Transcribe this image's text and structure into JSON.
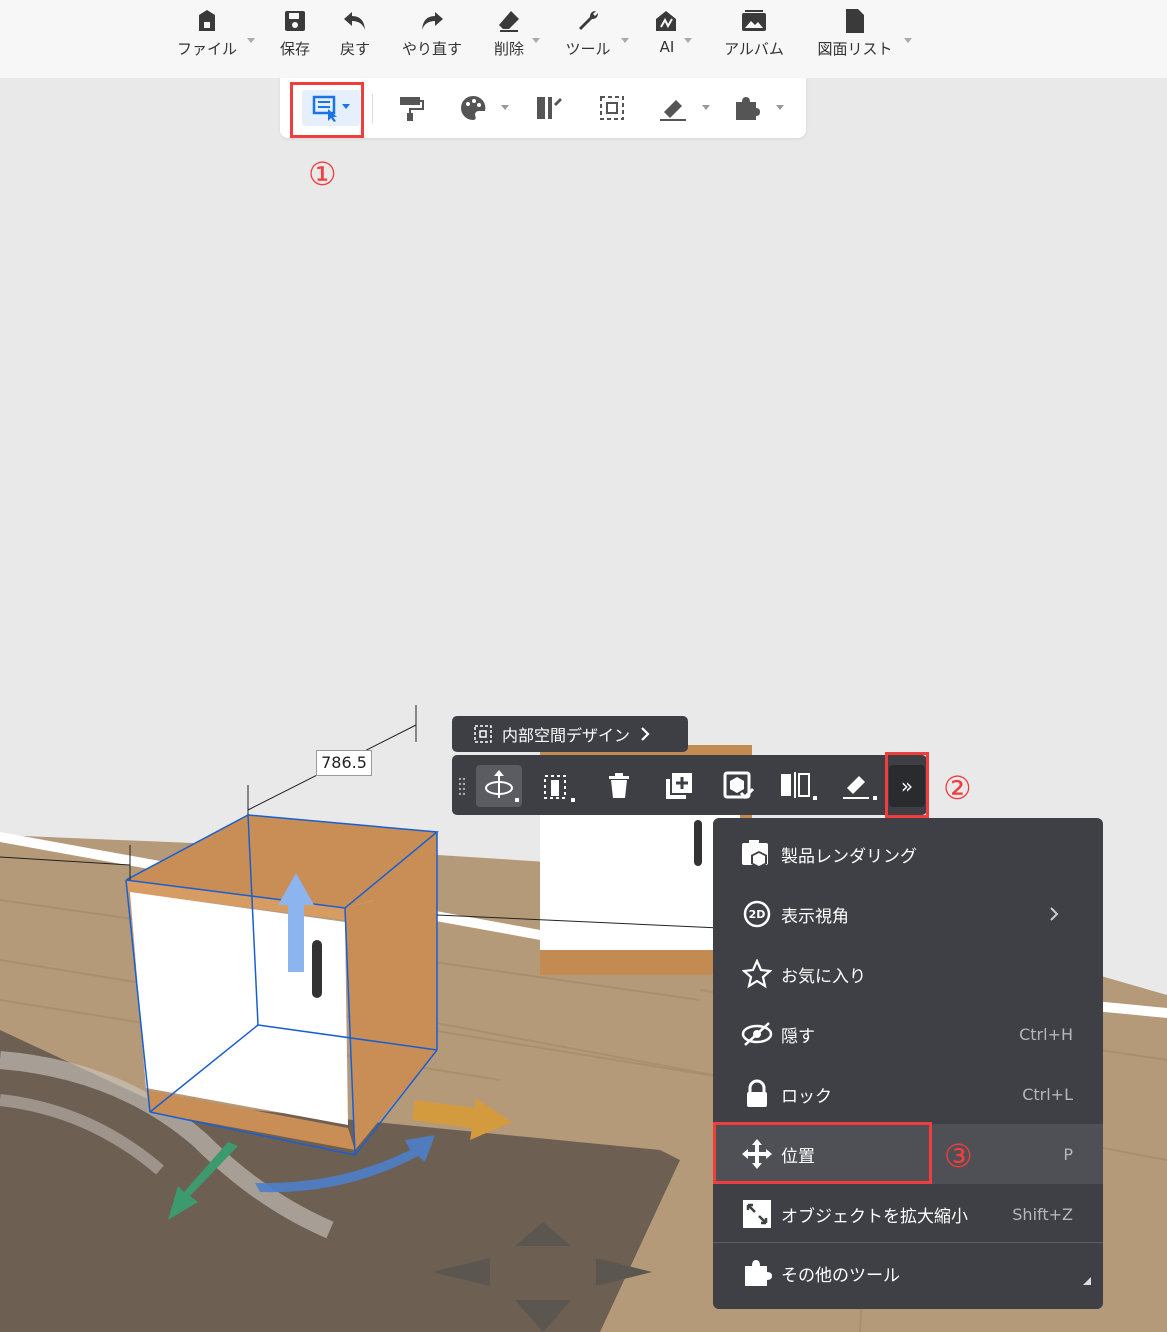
{
  "topbar": {
    "items": [
      {
        "label": "ファイル",
        "icon": "home-icon"
      },
      {
        "label": "保存",
        "icon": "save-icon"
      },
      {
        "label": "戻す",
        "icon": "undo-icon"
      },
      {
        "label": "やり直す",
        "icon": "redo-icon"
      },
      {
        "label": "削除",
        "icon": "eraser-icon"
      },
      {
        "label": "ツール",
        "icon": "wrench-icon"
      },
      {
        "label": "AI",
        "icon": "ai-icon"
      },
      {
        "label": "アルバム",
        "icon": "album-icon"
      },
      {
        "label": "図面リスト",
        "icon": "document-icon"
      }
    ]
  },
  "annotations": {
    "step1": "①",
    "step2": "②",
    "step3": "③"
  },
  "scene": {
    "dimension_label": "786.5"
  },
  "floating_toolbar": {
    "inner_design_label": "内部空間デザイン",
    "more_label": "»"
  },
  "context_menu": {
    "items": [
      {
        "label": "製品レンダリング",
        "shortcut": ""
      },
      {
        "label": "表示視角",
        "shortcut": ""
      },
      {
        "label": "お気に入り",
        "shortcut": ""
      },
      {
        "label": "隠す",
        "shortcut": "Ctrl+H"
      },
      {
        "label": "ロック",
        "shortcut": "Ctrl+L"
      },
      {
        "label": "位置",
        "shortcut": "P"
      },
      {
        "label": "オブジェクトを拡大縮小",
        "shortcut": "Shift+Z"
      },
      {
        "label": "その他のツール",
        "shortcut": ""
      }
    ],
    "view_angle_badge": "2D"
  },
  "colors": {
    "accent": "#1a73e8",
    "highlight": "#ef3e3e",
    "menu_bg": "#3f4045",
    "toolbar_bg": "#3d3f44"
  }
}
